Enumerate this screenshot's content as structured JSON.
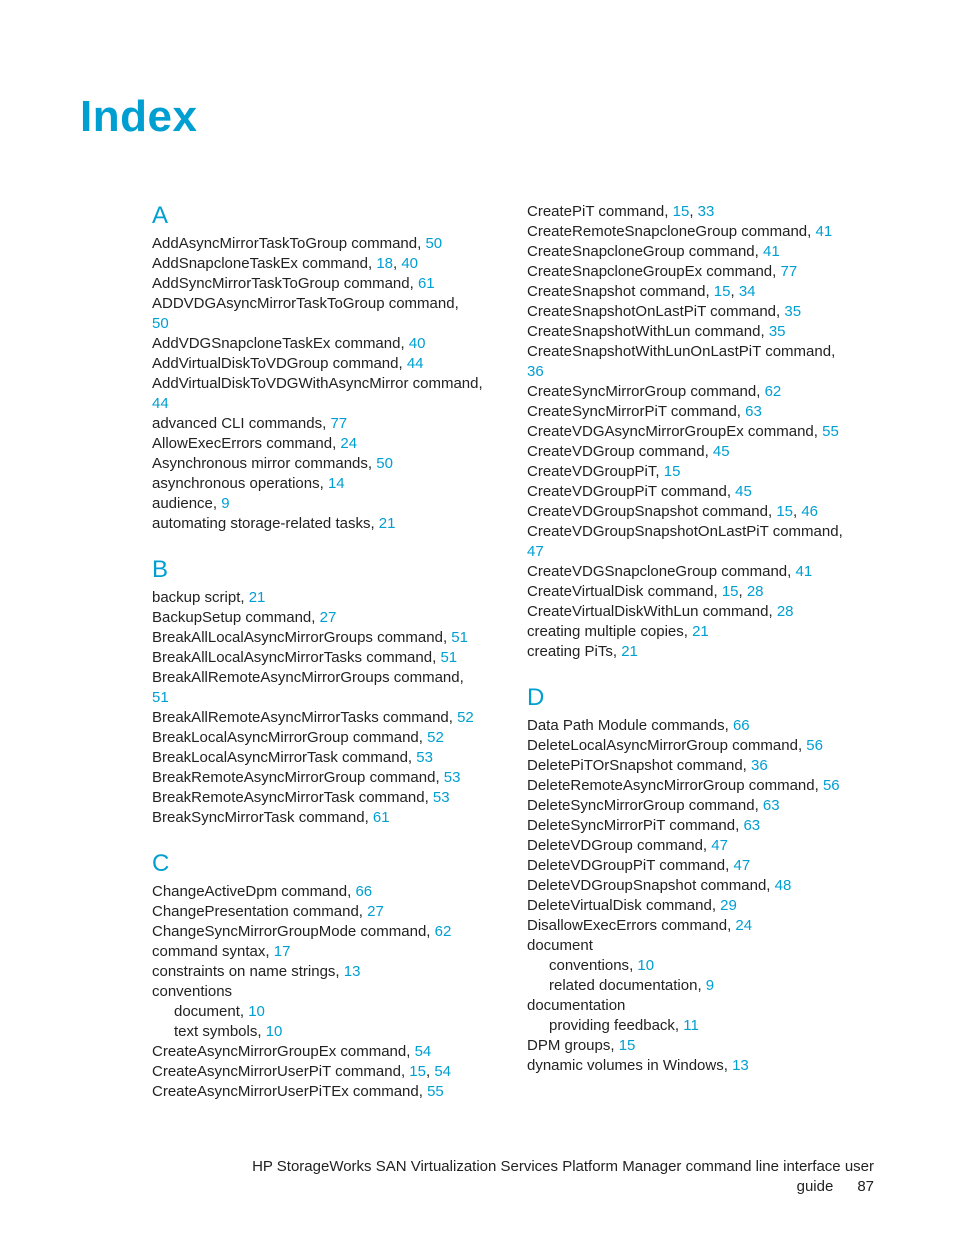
{
  "title": "Index",
  "footer": {
    "line1": "HP StorageWorks SAN Virtualization Services Platform Manager command line interface user",
    "line2_text": "guide",
    "page_number": "87"
  },
  "left_column": [
    {
      "type": "letter",
      "text": "A"
    },
    {
      "type": "entry",
      "text": "AddAsyncMirrorTaskToGroup command",
      "pages": [
        "50"
      ]
    },
    {
      "type": "entry",
      "text": "AddSnapcloneTaskEx command",
      "pages": [
        "18",
        "40"
      ]
    },
    {
      "type": "entry",
      "text": "AddSyncMirrorTaskToGroup command",
      "pages": [
        "61"
      ]
    },
    {
      "type": "entry",
      "text": "ADDVDGAsyncMirrorTaskToGroup command",
      "pages": [
        "50"
      ],
      "wrap_pages": true
    },
    {
      "type": "entry",
      "text": "AddVDGSnapcloneTaskEx command",
      "pages": [
        "40"
      ]
    },
    {
      "type": "entry",
      "text": "AddVirtualDiskToVDGroup command",
      "pages": [
        "44"
      ]
    },
    {
      "type": "entry",
      "text": "AddVirtualDiskToVDGWithAsyncMirror command",
      "pages": [
        "44"
      ]
    },
    {
      "type": "entry",
      "text": "advanced CLI commands",
      "pages": [
        "77"
      ]
    },
    {
      "type": "entry",
      "text": "AllowExecErrors command",
      "pages": [
        "24"
      ]
    },
    {
      "type": "entry",
      "text": "Asynchronous mirror commands",
      "pages": [
        "50"
      ]
    },
    {
      "type": "entry",
      "text": "asynchronous operations",
      "pages": [
        "14"
      ]
    },
    {
      "type": "entry",
      "text": "audience",
      "pages": [
        "9"
      ]
    },
    {
      "type": "entry",
      "text": "automating storage-related tasks",
      "pages": [
        "21"
      ]
    },
    {
      "type": "letter",
      "text": "B"
    },
    {
      "type": "entry",
      "text": "backup script",
      "pages": [
        "21"
      ]
    },
    {
      "type": "entry",
      "text": "BackupSetup command",
      "pages": [
        "27"
      ]
    },
    {
      "type": "entry",
      "text": "BreakAllLocalAsyncMirrorGroups command",
      "pages": [
        "51"
      ]
    },
    {
      "type": "entry",
      "text": "BreakAllLocalAsyncMirrorTasks command",
      "pages": [
        "51"
      ]
    },
    {
      "type": "entry",
      "text": "BreakAllRemoteAsyncMirrorGroups command",
      "pages": [
        "51"
      ],
      "wrap_pages": true
    },
    {
      "type": "entry",
      "text": "BreakAllRemoteAsyncMirrorTasks command",
      "pages": [
        "52"
      ]
    },
    {
      "type": "entry",
      "text": "BreakLocalAsyncMirrorGroup command",
      "pages": [
        "52"
      ]
    },
    {
      "type": "entry",
      "text": "BreakLocalAsyncMirrorTask command",
      "pages": [
        "53"
      ]
    },
    {
      "type": "entry",
      "text": "BreakRemoteAsyncMirrorGroup command",
      "pages": [
        "53"
      ]
    },
    {
      "type": "entry",
      "text": "BreakRemoteAsyncMirrorTask command",
      "pages": [
        "53"
      ]
    },
    {
      "type": "entry",
      "text": "BreakSyncMirrorTask command",
      "pages": [
        "61"
      ]
    },
    {
      "type": "letter",
      "text": "C"
    },
    {
      "type": "entry",
      "text": "ChangeActiveDpm command",
      "pages": [
        "66"
      ]
    },
    {
      "type": "entry",
      "text": "ChangePresentation command",
      "pages": [
        "27"
      ]
    },
    {
      "type": "entry",
      "text": "ChangeSyncMirrorGroupMode command",
      "pages": [
        "62"
      ]
    },
    {
      "type": "entry",
      "text": "command syntax",
      "pages": [
        "17"
      ]
    },
    {
      "type": "entry",
      "text": "constraints on name strings",
      "pages": [
        "13"
      ]
    },
    {
      "type": "entry",
      "text": "conventions",
      "pages": []
    },
    {
      "type": "entry",
      "text": "document",
      "pages": [
        "10"
      ],
      "indent": true
    },
    {
      "type": "entry",
      "text": "text symbols",
      "pages": [
        "10"
      ],
      "indent": true
    },
    {
      "type": "entry",
      "text": "CreateAsyncMirrorGroupEx command",
      "pages": [
        "54"
      ]
    },
    {
      "type": "entry",
      "text": "CreateAsyncMirrorUserPiT command",
      "pages": [
        "15",
        "54"
      ]
    },
    {
      "type": "entry",
      "text": "CreateAsyncMirrorUserPiTEx command",
      "pages": [
        "55"
      ]
    }
  ],
  "right_column": [
    {
      "type": "entry",
      "text": "CreatePiT command",
      "pages": [
        "15",
        "33"
      ]
    },
    {
      "type": "entry",
      "text": "CreateRemoteSnapcloneGroup command",
      "pages": [
        "41"
      ]
    },
    {
      "type": "entry",
      "text": "CreateSnapcloneGroup command",
      "pages": [
        "41"
      ]
    },
    {
      "type": "entry",
      "text": "CreateSnapcloneGroupEx command",
      "pages": [
        "77"
      ]
    },
    {
      "type": "entry",
      "text": "CreateSnapshot command",
      "pages": [
        "15",
        "34"
      ]
    },
    {
      "type": "entry",
      "text": "CreateSnapshotOnLastPiT command",
      "pages": [
        "35"
      ]
    },
    {
      "type": "entry",
      "text": "CreateSnapshotWithLun command",
      "pages": [
        "35"
      ]
    },
    {
      "type": "entry",
      "text": "CreateSnapshotWithLunOnLastPiT command",
      "pages": [
        "36"
      ],
      "wrap_pages": true
    },
    {
      "type": "entry",
      "text": "CreateSyncMirrorGroup command",
      "pages": [
        "62"
      ]
    },
    {
      "type": "entry",
      "text": "CreateSyncMirrorPiT command",
      "pages": [
        "63"
      ]
    },
    {
      "type": "entry",
      "text": "CreateVDGAsyncMirrorGroupEx command",
      "pages": [
        "55"
      ]
    },
    {
      "type": "entry",
      "text": "CreateVDGroup command",
      "pages": [
        "45"
      ]
    },
    {
      "type": "entry",
      "text": "CreateVDGroupPiT",
      "pages": [
        "15"
      ]
    },
    {
      "type": "entry",
      "text": "CreateVDGroupPiT command",
      "pages": [
        "45"
      ]
    },
    {
      "type": "entry",
      "text": "CreateVDGroupSnapshot command",
      "pages": [
        "15",
        "46"
      ]
    },
    {
      "type": "entry",
      "text": "CreateVDGroupSnapshotOnLastPiT command",
      "pages": [
        "47"
      ],
      "wrap_pages": true
    },
    {
      "type": "entry",
      "text": "CreateVDGSnapcloneGroup command",
      "pages": [
        "41"
      ]
    },
    {
      "type": "entry",
      "text": "CreateVirtualDisk command",
      "pages": [
        "15",
        "28"
      ]
    },
    {
      "type": "entry",
      "text": "CreateVirtualDiskWithLun command",
      "pages": [
        "28"
      ]
    },
    {
      "type": "entry",
      "text": "creating multiple copies",
      "pages": [
        "21"
      ]
    },
    {
      "type": "entry",
      "text": "creating PiTs",
      "pages": [
        "21"
      ]
    },
    {
      "type": "letter",
      "text": "D"
    },
    {
      "type": "entry",
      "text": "Data Path Module commands",
      "pages": [
        "66"
      ]
    },
    {
      "type": "entry",
      "text": "DeleteLocalAsyncMirrorGroup command",
      "pages": [
        "56"
      ]
    },
    {
      "type": "entry",
      "text": "DeletePiTOrSnapshot command",
      "pages": [
        "36"
      ]
    },
    {
      "type": "entry",
      "text": "DeleteRemoteAsyncMirrorGroup command",
      "pages": [
        "56"
      ]
    },
    {
      "type": "entry",
      "text": "DeleteSyncMirrorGroup command",
      "pages": [
        "63"
      ]
    },
    {
      "type": "entry",
      "text": "DeleteSyncMirrorPiT command",
      "pages": [
        "63"
      ]
    },
    {
      "type": "entry",
      "text": "DeleteVDGroup command",
      "pages": [
        "47"
      ]
    },
    {
      "type": "entry",
      "text": "DeleteVDGroupPiT command",
      "pages": [
        "47"
      ]
    },
    {
      "type": "entry",
      "text": "DeleteVDGroupSnapshot command",
      "pages": [
        "48"
      ]
    },
    {
      "type": "entry",
      "text": "DeleteVirtualDisk command",
      "pages": [
        "29"
      ]
    },
    {
      "type": "entry",
      "text": "DisallowExecErrors command",
      "pages": [
        "24"
      ]
    },
    {
      "type": "entry",
      "text": "document",
      "pages": []
    },
    {
      "type": "entry",
      "text": "conventions",
      "pages": [
        "10"
      ],
      "indent": true
    },
    {
      "type": "entry",
      "text": "related documentation",
      "pages": [
        "9"
      ],
      "indent": true
    },
    {
      "type": "entry",
      "text": "documentation",
      "pages": []
    },
    {
      "type": "entry",
      "text": "providing feedback",
      "pages": [
        "11"
      ],
      "indent": true
    },
    {
      "type": "entry",
      "text": "DPM groups",
      "pages": [
        "15"
      ]
    },
    {
      "type": "entry",
      "text": "dynamic volumes in Windows",
      "pages": [
        "13"
      ]
    }
  ]
}
